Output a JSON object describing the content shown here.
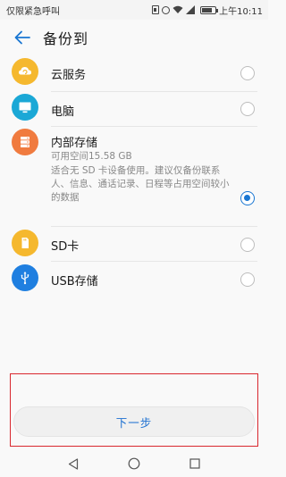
{
  "status_bar": {
    "carrier_text": "仅限紧急呼叫",
    "time": "上午10:11",
    "battery_level": 0.8
  },
  "header": {
    "title": "备份到",
    "back_icon": "arrow-left-icon"
  },
  "options": [
    {
      "id": "cloud",
      "label": "云服务",
      "icon": "cloud-sync-icon",
      "icon_color": "#f5b82e",
      "selected": false
    },
    {
      "id": "pc",
      "label": "电脑",
      "icon": "monitor-icon",
      "icon_color": "#1ba8d6",
      "selected": false
    },
    {
      "id": "internal",
      "label": "内部存储",
      "icon": "storage-icon",
      "icon_color": "#f07b3f",
      "selected": true,
      "available_space": "可用空间15.58 GB",
      "description": "适合无 SD 卡设备使用。建议仅备份联系人、信息、通话记录、日程等占用空间较小的数据"
    },
    {
      "id": "sd",
      "label": "SD卡",
      "icon": "sd-card-icon",
      "icon_color": "#f5b82e",
      "selected": false
    },
    {
      "id": "usb",
      "label": "USB存储",
      "icon": "usb-icon",
      "icon_color": "#1f7fe0",
      "selected": false
    }
  ],
  "actions": {
    "next_label": "下一步"
  },
  "colors": {
    "accent": "#1976d2",
    "highlight": "#d9272e"
  },
  "nav_bar": {
    "back": "triangle-back-icon",
    "home": "circle-home-icon",
    "recents": "square-recents-icon"
  }
}
